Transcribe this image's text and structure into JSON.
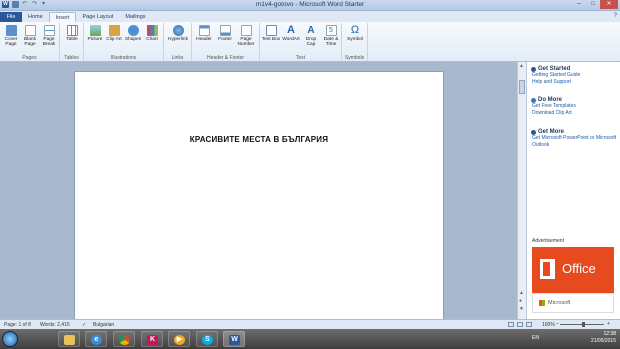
{
  "title_bar": {
    "title": "m1v4-gotovo - Microsoft Word Starter",
    "app_icon": "W",
    "quick_access": [
      "save-icon",
      "undo-icon",
      "redo-icon",
      "customize-icon"
    ],
    "window_controls": {
      "minimize": "–",
      "maximize": "□",
      "close": "✕"
    }
  },
  "tabs": [
    {
      "label": "File"
    },
    {
      "label": "Home"
    },
    {
      "label": "Insert"
    },
    {
      "label": "Page Layout"
    },
    {
      "label": "Mailings"
    }
  ],
  "ribbon": {
    "groups": {
      "pages": "Pages",
      "tables": "Tables",
      "illustrations": "Illustrations",
      "links": "Links",
      "header_footer": "Header & Footer",
      "text": "Text",
      "symbols": "Symbols"
    },
    "buttons": {
      "cover_page": "Cover Page",
      "blank_page": "Blank Page",
      "page_break": "Page Break",
      "table": "Table",
      "picture": "Picture",
      "clip_art": "Clip Art",
      "shapes": "Shapes",
      "chart": "Chart",
      "hyperlink": "Hyperlink",
      "header": "Header",
      "footer": "Footer",
      "page_number": "Page Number",
      "text_box": "Text Box",
      "wordart": "WordArt",
      "drop_cap": "Drop Cap",
      "date_time": "Date & Time",
      "symbol": "Symbol",
      "symbol_glyph": "Ω"
    }
  },
  "document": {
    "heading": "КРАСИВИТЕ МЕСТА В БЪЛГАРИЯ"
  },
  "side_pane": {
    "sections": [
      {
        "title": "Get Started",
        "links": [
          "Getting Started Guide",
          "Help and Support"
        ]
      },
      {
        "title": "Do More",
        "links": [
          "Get Free Templates",
          "Download Clip Art"
        ]
      },
      {
        "title": "Get More",
        "links": [
          "Get Microsoft PowerPoint or Microsoft Outlook"
        ]
      }
    ],
    "ad_label": "Advertisement",
    "ad_product": "Office",
    "ad_brand": "Microsoft"
  },
  "status_bar": {
    "page": "Page: 1 of 8",
    "words": "Words: 2,415",
    "language": "Bulgarian",
    "zoom": "100%",
    "zoom_minus": "−",
    "zoom_plus": "+"
  },
  "taskbar": {
    "language": "EN",
    "time": "12:38",
    "date": "21/05/2015",
    "apps": [
      "explorer",
      "internet-explorer",
      "chrome",
      "k-app",
      "media-player",
      "skype",
      "word"
    ]
  }
}
